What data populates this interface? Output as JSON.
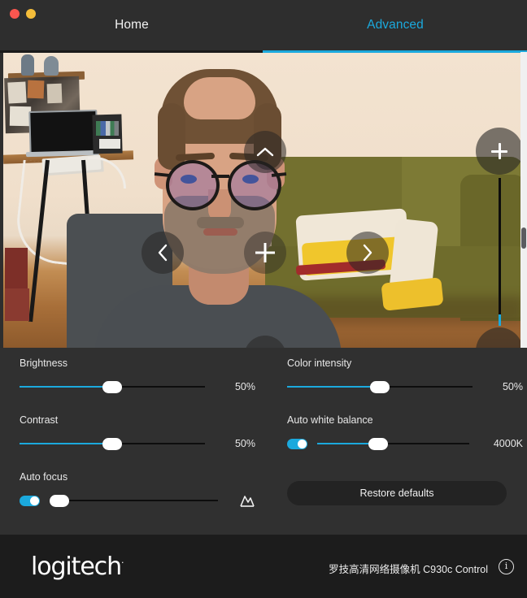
{
  "window": {
    "traffic_lights": [
      {
        "name": "close",
        "color": "#f9564f"
      },
      {
        "name": "minimize",
        "color": "#f4bd3a"
      }
    ]
  },
  "tabs": [
    {
      "label": "Home",
      "active": false
    },
    {
      "label": "Advanced",
      "active": true
    }
  ],
  "accent_color": "#1ba9dd",
  "preview": {
    "pan_tilt": {
      "up_icon": "chevron-up-icon",
      "down_icon": "chevron-down-icon",
      "left_icon": "chevron-left-icon",
      "right_icon": "chevron-right-icon",
      "center_icon": "crosshair-icon"
    },
    "zoom": {
      "increase_icon": "plus-icon",
      "decrease_icon": "minus-icon",
      "level_percent": 8
    }
  },
  "controls": [
    {
      "name": "brightness",
      "label": "Brightness",
      "value": "50%",
      "fill_percent": 50,
      "has_toggle": false,
      "toggle_on": false,
      "disabled": false
    },
    {
      "name": "contrast",
      "label": "Contrast",
      "value": "50%",
      "fill_percent": 50,
      "has_toggle": false,
      "toggle_on": false,
      "disabled": false
    },
    {
      "name": "auto-focus",
      "label": "Auto focus",
      "value": "",
      "fill_percent": 0,
      "has_toggle": true,
      "toggle_on": true,
      "disabled": true,
      "icon": "mountain-focus-icon"
    },
    {
      "name": "color-intensity",
      "label": "Color intensity",
      "value": "50%",
      "fill_percent": 50,
      "has_toggle": false,
      "toggle_on": false,
      "disabled": false
    },
    {
      "name": "auto-white-balance",
      "label": "Auto white balance",
      "value": "4000K",
      "fill_percent": 40,
      "has_toggle": true,
      "toggle_on": true,
      "disabled": false
    }
  ],
  "restore_button": {
    "label": "Restore defaults"
  },
  "footer": {
    "brand": "logitech",
    "brand_mark": "·",
    "device_name": "罗技高清网络摄像机 C930c Control",
    "info_icon": "info-icon"
  }
}
